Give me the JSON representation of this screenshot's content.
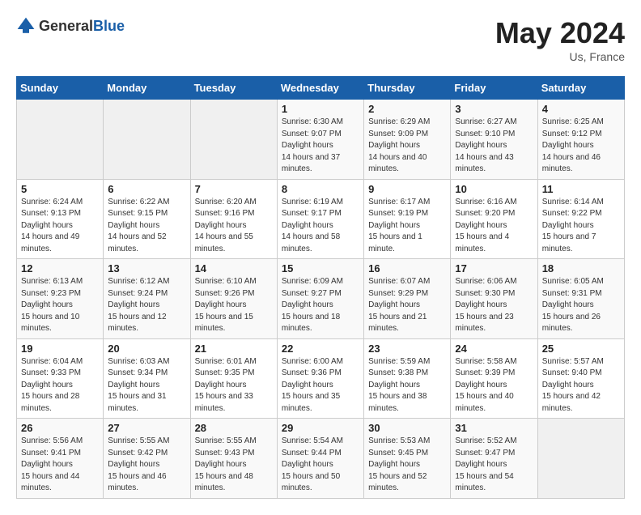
{
  "header": {
    "logo_general": "General",
    "logo_blue": "Blue",
    "month": "May 2024",
    "location": "Us, France"
  },
  "days_of_week": [
    "Sunday",
    "Monday",
    "Tuesday",
    "Wednesday",
    "Thursday",
    "Friday",
    "Saturday"
  ],
  "weeks": [
    [
      {
        "day": "",
        "empty": true
      },
      {
        "day": "",
        "empty": true
      },
      {
        "day": "",
        "empty": true
      },
      {
        "day": "1",
        "sunrise": "6:30 AM",
        "sunset": "9:07 PM",
        "daylight": "14 hours and 37 minutes."
      },
      {
        "day": "2",
        "sunrise": "6:29 AM",
        "sunset": "9:09 PM",
        "daylight": "14 hours and 40 minutes."
      },
      {
        "day": "3",
        "sunrise": "6:27 AM",
        "sunset": "9:10 PM",
        "daylight": "14 hours and 43 minutes."
      },
      {
        "day": "4",
        "sunrise": "6:25 AM",
        "sunset": "9:12 PM",
        "daylight": "14 hours and 46 minutes."
      }
    ],
    [
      {
        "day": "5",
        "sunrise": "6:24 AM",
        "sunset": "9:13 PM",
        "daylight": "14 hours and 49 minutes."
      },
      {
        "day": "6",
        "sunrise": "6:22 AM",
        "sunset": "9:15 PM",
        "daylight": "14 hours and 52 minutes."
      },
      {
        "day": "7",
        "sunrise": "6:20 AM",
        "sunset": "9:16 PM",
        "daylight": "14 hours and 55 minutes."
      },
      {
        "day": "8",
        "sunrise": "6:19 AM",
        "sunset": "9:17 PM",
        "daylight": "14 hours and 58 minutes."
      },
      {
        "day": "9",
        "sunrise": "6:17 AM",
        "sunset": "9:19 PM",
        "daylight": "15 hours and 1 minute."
      },
      {
        "day": "10",
        "sunrise": "6:16 AM",
        "sunset": "9:20 PM",
        "daylight": "15 hours and 4 minutes."
      },
      {
        "day": "11",
        "sunrise": "6:14 AM",
        "sunset": "9:22 PM",
        "daylight": "15 hours and 7 minutes."
      }
    ],
    [
      {
        "day": "12",
        "sunrise": "6:13 AM",
        "sunset": "9:23 PM",
        "daylight": "15 hours and 10 minutes."
      },
      {
        "day": "13",
        "sunrise": "6:12 AM",
        "sunset": "9:24 PM",
        "daylight": "15 hours and 12 minutes."
      },
      {
        "day": "14",
        "sunrise": "6:10 AM",
        "sunset": "9:26 PM",
        "daylight": "15 hours and 15 minutes."
      },
      {
        "day": "15",
        "sunrise": "6:09 AM",
        "sunset": "9:27 PM",
        "daylight": "15 hours and 18 minutes."
      },
      {
        "day": "16",
        "sunrise": "6:07 AM",
        "sunset": "9:29 PM",
        "daylight": "15 hours and 21 minutes."
      },
      {
        "day": "17",
        "sunrise": "6:06 AM",
        "sunset": "9:30 PM",
        "daylight": "15 hours and 23 minutes."
      },
      {
        "day": "18",
        "sunrise": "6:05 AM",
        "sunset": "9:31 PM",
        "daylight": "15 hours and 26 minutes."
      }
    ],
    [
      {
        "day": "19",
        "sunrise": "6:04 AM",
        "sunset": "9:33 PM",
        "daylight": "15 hours and 28 minutes."
      },
      {
        "day": "20",
        "sunrise": "6:03 AM",
        "sunset": "9:34 PM",
        "daylight": "15 hours and 31 minutes."
      },
      {
        "day": "21",
        "sunrise": "6:01 AM",
        "sunset": "9:35 PM",
        "daylight": "15 hours and 33 minutes."
      },
      {
        "day": "22",
        "sunrise": "6:00 AM",
        "sunset": "9:36 PM",
        "daylight": "15 hours and 35 minutes."
      },
      {
        "day": "23",
        "sunrise": "5:59 AM",
        "sunset": "9:38 PM",
        "daylight": "15 hours and 38 minutes."
      },
      {
        "day": "24",
        "sunrise": "5:58 AM",
        "sunset": "9:39 PM",
        "daylight": "15 hours and 40 minutes."
      },
      {
        "day": "25",
        "sunrise": "5:57 AM",
        "sunset": "9:40 PM",
        "daylight": "15 hours and 42 minutes."
      }
    ],
    [
      {
        "day": "26",
        "sunrise": "5:56 AM",
        "sunset": "9:41 PM",
        "daylight": "15 hours and 44 minutes."
      },
      {
        "day": "27",
        "sunrise": "5:55 AM",
        "sunset": "9:42 PM",
        "daylight": "15 hours and 46 minutes."
      },
      {
        "day": "28",
        "sunrise": "5:55 AM",
        "sunset": "9:43 PM",
        "daylight": "15 hours and 48 minutes."
      },
      {
        "day": "29",
        "sunrise": "5:54 AM",
        "sunset": "9:44 PM",
        "daylight": "15 hours and 50 minutes."
      },
      {
        "day": "30",
        "sunrise": "5:53 AM",
        "sunset": "9:45 PM",
        "daylight": "15 hours and 52 minutes."
      },
      {
        "day": "31",
        "sunrise": "5:52 AM",
        "sunset": "9:47 PM",
        "daylight": "15 hours and 54 minutes."
      },
      {
        "day": "",
        "empty": true
      }
    ]
  ],
  "labels": {
    "sunrise": "Sunrise:",
    "sunset": "Sunset:",
    "daylight": "Daylight hours"
  }
}
